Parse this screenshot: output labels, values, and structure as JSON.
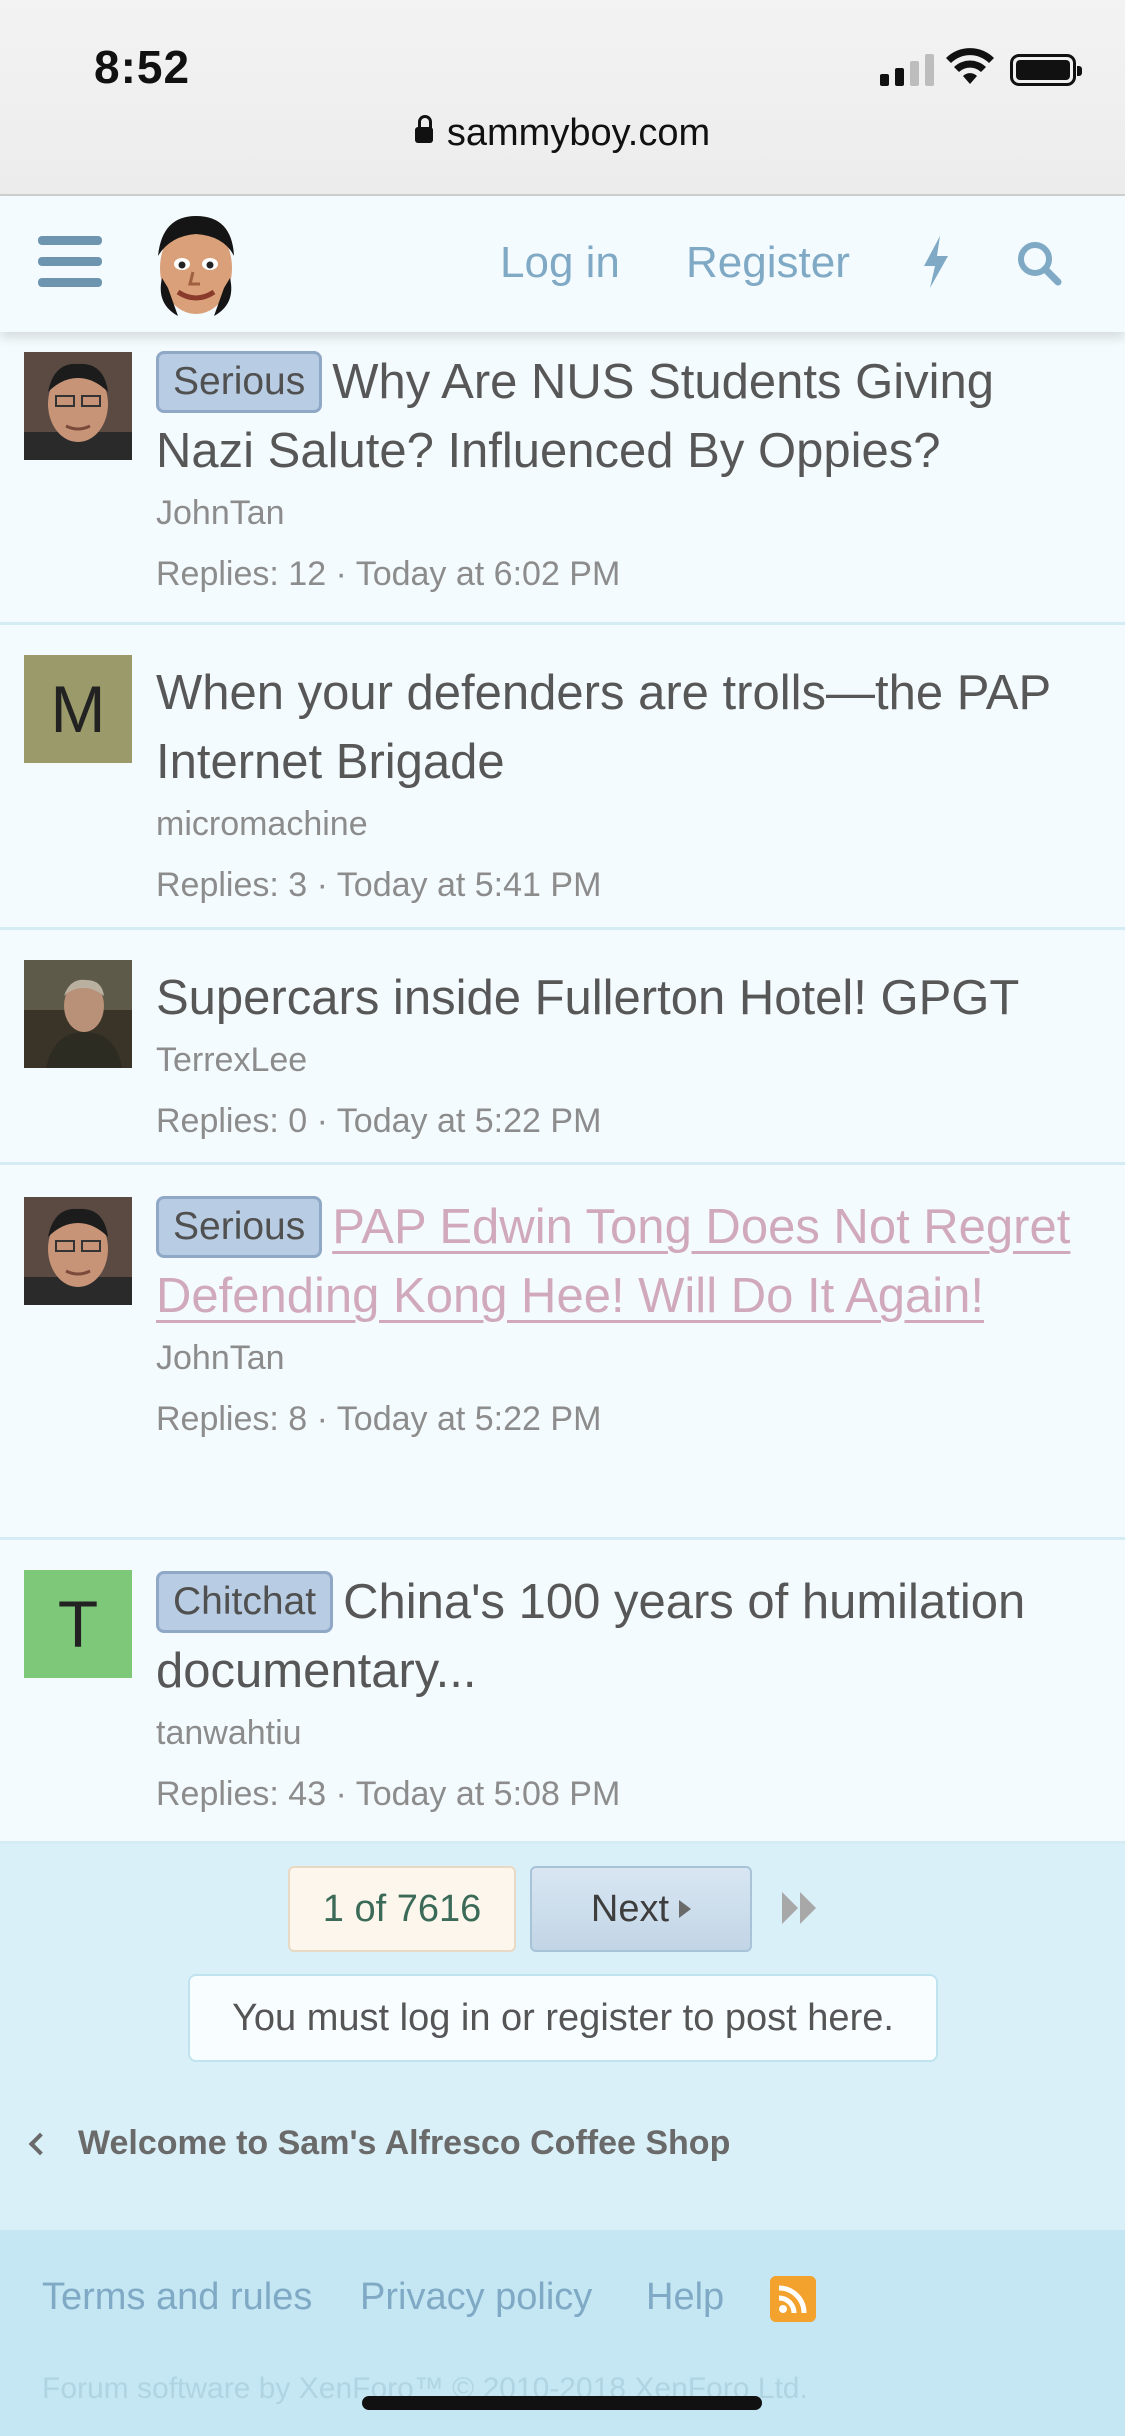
{
  "status_bar": {
    "time": "8:52",
    "url": "sammyboy.com"
  },
  "header": {
    "login_label": "Log in",
    "register_label": "Register"
  },
  "threads": [
    {
      "prefix": "Serious",
      "title": "Why Are NUS Students Giving Nazi Salute? Influenced By Oppies?",
      "author": "JohnTan",
      "meta": "Replies: 12 · Today at 6:02 PM",
      "avatar_type": "photo-man"
    },
    {
      "prefix": "",
      "title": "When your defenders are trolls—the PAP Internet Brigade",
      "author": "micromachine",
      "meta": "Replies: 3 · Today at 5:41 PM",
      "avatar_letter": "M",
      "avatar_color": "#9a9a6a"
    },
    {
      "prefix": "",
      "title": "Supercars inside Fullerton Hotel! GPGT",
      "author": "TerrexLee",
      "meta": "Replies: 0 · Today at 5:22 PM",
      "avatar_type": "photo-dark"
    },
    {
      "prefix": "Serious",
      "title": "PAP Edwin Tong Does Not Regret Defending Kong Hee! Will Do It Again!",
      "author": "JohnTan",
      "meta": "Replies: 8 · Today at 5:22 PM",
      "avatar_type": "photo-man",
      "visited": true
    },
    {
      "prefix": "Chitchat",
      "title": "China's 100 years of humilation documentary...",
      "author": "tanwahtiu",
      "meta": "Replies: 43 · Today at 5:08 PM",
      "avatar_letter": "T",
      "avatar_color": "#7ec87a"
    }
  ],
  "pagination": {
    "current": "1 of 7616",
    "next_label": "Next"
  },
  "notice": "You must log in or register to post here.",
  "breadcrumb": "Welcome to Sam's Alfresco Coffee Shop",
  "footer": {
    "links": [
      "Terms and rules",
      "Privacy policy",
      "Help"
    ],
    "copyright": "Forum software by XenForo™ © 2010-2018 XenForo Ltd."
  },
  "colors": {
    "link": "#7fa9c4",
    "prefix_bg": "#b8cde3",
    "visited_link": "#d1a9bd",
    "rss": "#f3a22e"
  }
}
